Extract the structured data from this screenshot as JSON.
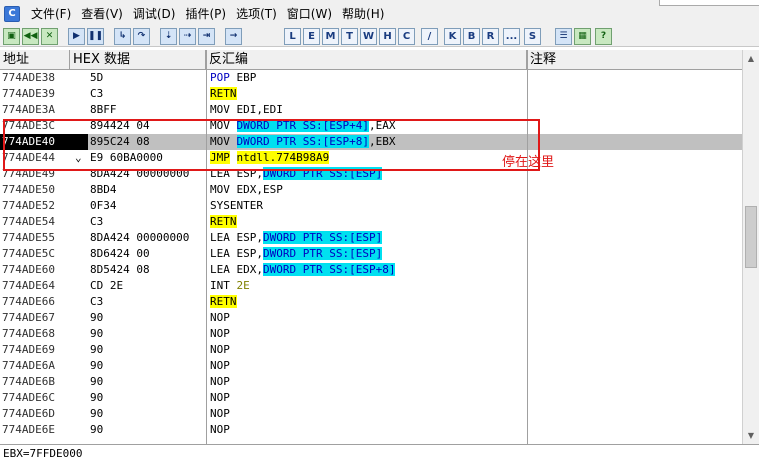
{
  "menu": {
    "app_icon": "C",
    "items": [
      "文件(F)",
      "查看(V)",
      "调试(D)",
      "插件(P)",
      "选项(T)",
      "窗口(W)",
      "帮助(H)"
    ]
  },
  "toolbar": {
    "playback_buttons": [
      "open-icon",
      "rewind-icon",
      "close-icon",
      "run-icon",
      "pause-icon",
      "step-into-icon",
      "step-over-icon",
      "trace-into-icon",
      "trace-over-icon",
      "execute-till-return-icon",
      "goto-icon"
    ],
    "letter_buttons": [
      "L",
      "E",
      "M",
      "T",
      "W",
      "H",
      "C",
      "/",
      "K",
      "B",
      "R",
      "...",
      "S"
    ],
    "extra_buttons": [
      "list-icon",
      "help-icon"
    ]
  },
  "columns": {
    "address": "地址",
    "hex": "HEX 数据",
    "disasm": "反汇编",
    "comment": "注释"
  },
  "rows": [
    {
      "addr": "774ADE38",
      "hex": "5D",
      "mn": "POP",
      "mn_style": "blue",
      "ops": [
        {
          "t": "EBP"
        }
      ]
    },
    {
      "addr": "774ADE39",
      "hex": "C3",
      "mn": "RETN",
      "mn_style": "yel",
      "ops": []
    },
    {
      "addr": "774ADE3A",
      "hex": "8BFF",
      "mn": "MOV",
      "mn_style": "",
      "ops": [
        {
          "t": "EDI,EDI"
        }
      ]
    },
    {
      "addr": "774ADE3C",
      "hex": "894424 04",
      "mn": "MOV",
      "mn_style": "",
      "ops": [
        {
          "t": "DWORD PTR SS:[ESP+4]",
          "s": "cyan"
        },
        {
          "t": ",EAX"
        }
      ]
    },
    {
      "addr": "774ADE40",
      "hex": "895C24 08",
      "mn": "MOV",
      "mn_style": "",
      "ops": [
        {
          "t": "DWORD PTR SS:[ESP+8]",
          "s": "cyan"
        },
        {
          "t": ",EBX"
        }
      ],
      "current": true
    },
    {
      "addr": "774ADE44",
      "hex": "E9 60BA0000",
      "mn": "JMP",
      "mn_style": "yel",
      "ops": [
        {
          "t": "ntdll.774B98A9",
          "s": "yel"
        }
      ],
      "arrow": "⌄"
    },
    {
      "addr": "774ADE49",
      "hex": "8DA424 00000000",
      "mn": "LEA",
      "mn_style": "",
      "ops": [
        {
          "t": "ESP,"
        },
        {
          "t": "DWORD PTR SS:[ESP]",
          "s": "cyan"
        }
      ]
    },
    {
      "addr": "774ADE50",
      "hex": "8BD4",
      "mn": "MOV",
      "mn_style": "",
      "ops": [
        {
          "t": "EDX,ESP"
        }
      ]
    },
    {
      "addr": "774ADE52",
      "hex": "0F34",
      "mn": "SYSENTER",
      "mn_style": "",
      "ops": []
    },
    {
      "addr": "774ADE54",
      "hex": "C3",
      "mn": "RETN",
      "mn_style": "yel",
      "ops": []
    },
    {
      "addr": "774ADE55",
      "hex": "8DA424 00000000",
      "mn": "LEA",
      "mn_style": "",
      "ops": [
        {
          "t": "ESP,"
        },
        {
          "t": "DWORD PTR SS:[ESP]",
          "s": "cyan"
        }
      ]
    },
    {
      "addr": "774ADE5C",
      "hex": "8D6424 00",
      "mn": "LEA",
      "mn_style": "",
      "ops": [
        {
          "t": "ESP,"
        },
        {
          "t": "DWORD PTR SS:[ESP]",
          "s": "cyan"
        }
      ]
    },
    {
      "addr": "774ADE60",
      "hex": "8D5424 08",
      "mn": "LEA",
      "mn_style": "",
      "ops": [
        {
          "t": "EDX,"
        },
        {
          "t": "DWORD PTR SS:[ESP+8]",
          "s": "cyan"
        }
      ]
    },
    {
      "addr": "774ADE64",
      "hex": "CD 2E",
      "mn": "INT",
      "mn_style": "",
      "ops": [
        {
          "t": "2E",
          "s": "olive"
        }
      ]
    },
    {
      "addr": "774ADE66",
      "hex": "C3",
      "mn": "RETN",
      "mn_style": "yel",
      "ops": []
    },
    {
      "addr": "774ADE67",
      "hex": "90",
      "mn": "NOP",
      "mn_style": "",
      "ops": []
    },
    {
      "addr": "774ADE68",
      "hex": "90",
      "mn": "NOP",
      "mn_style": "",
      "ops": []
    },
    {
      "addr": "774ADE69",
      "hex": "90",
      "mn": "NOP",
      "mn_style": "",
      "ops": []
    },
    {
      "addr": "774ADE6A",
      "hex": "90",
      "mn": "NOP",
      "mn_style": "",
      "ops": []
    },
    {
      "addr": "774ADE6B",
      "hex": "90",
      "mn": "NOP",
      "mn_style": "",
      "ops": []
    },
    {
      "addr": "774ADE6C",
      "hex": "90",
      "mn": "NOP",
      "mn_style": "",
      "ops": []
    },
    {
      "addr": "774ADE6D",
      "hex": "90",
      "mn": "NOP",
      "mn_style": "",
      "ops": []
    },
    {
      "addr": "774ADE6E",
      "hex": "90",
      "mn": "NOP",
      "mn_style": "",
      "ops": []
    }
  ],
  "annotation": "停在这里",
  "status": "EBX=7FFDE000",
  "colors": {
    "accent_yellow": "#ffff00",
    "accent_cyan": "#00e0f0",
    "annotation_red": "#e01818",
    "current_row": "#c0c0c0"
  }
}
